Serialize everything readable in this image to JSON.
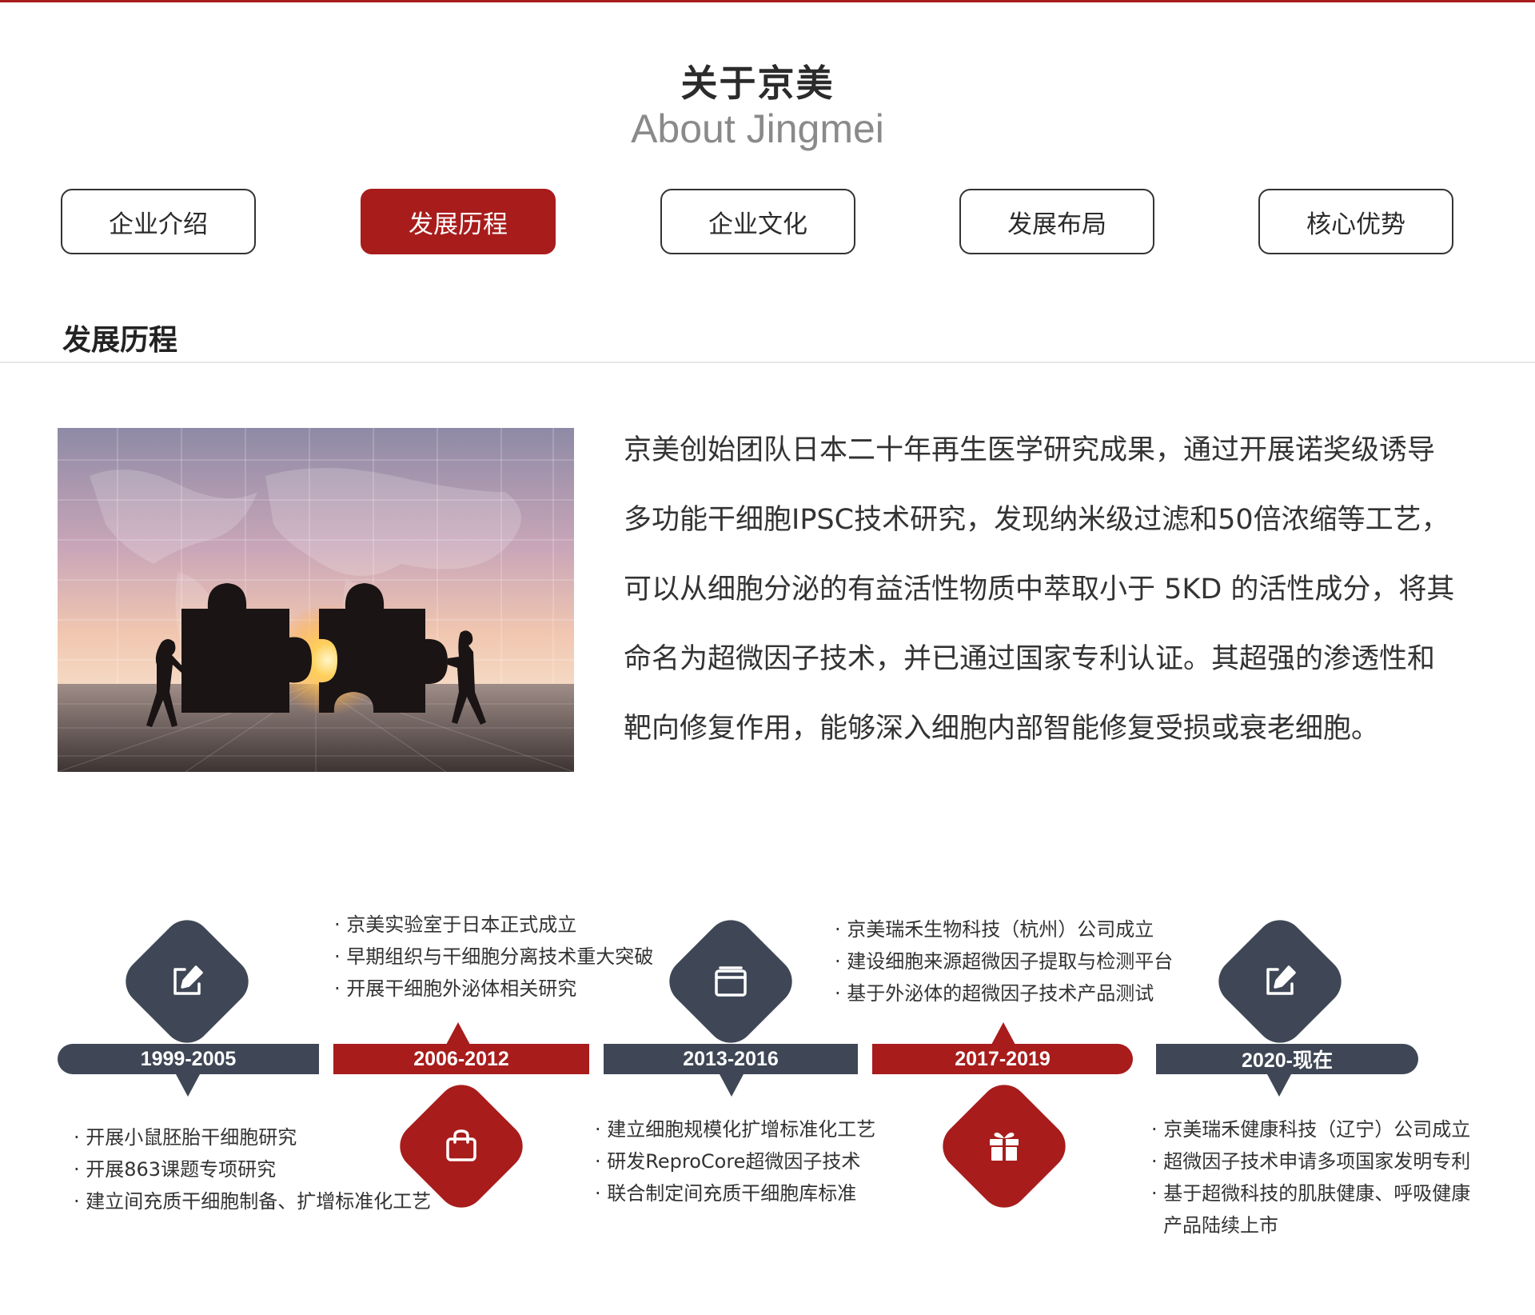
{
  "header": {
    "title_cn": "关于京美",
    "title_en": "About Jingmei"
  },
  "tabs": [
    {
      "label": "企业介绍",
      "active": false
    },
    {
      "label": "发展历程",
      "active": true
    },
    {
      "label": "企业文化",
      "active": false
    },
    {
      "label": "发展布局",
      "active": false
    },
    {
      "label": "核心优势",
      "active": false
    }
  ],
  "section": {
    "title": "发展历程"
  },
  "intro": {
    "lines": [
      "京美创始团队日本二十年再生医学研究成果，通过开展诺奖级诱导",
      "多功能干细胞IPSC技术研究，发现纳米级过滤和50倍浓缩等工艺，",
      "可以从细胞分泌的有益活性物质中萃取小于 5KD 的活性成分，将其",
      "命名为超微因子技术，并已通过国家专利认证。其超强的渗透性和",
      "靶向修复作用，能够深入细胞内部智能修复受损或衰老细胞。"
    ]
  },
  "timeline": {
    "colors": {
      "dark": "#3f4756",
      "red": "#a81c1c"
    },
    "periods": [
      {
        "label": "1999-2005",
        "icon": "edit-icon",
        "events": [
          "· 开展小鼠胚胎干细胞研究",
          "· 开展863课题专项研究",
          "· 建立间充质干细胞制备、扩增标准化工艺"
        ]
      },
      {
        "label": "2006-2012",
        "icon": "shopping-bag-icon",
        "events": [
          "· 京美实验室于日本正式成立",
          "· 早期组织与干细胞分离技术重大突破",
          "· 开展干细胞外泌体相关研究"
        ]
      },
      {
        "label": "2013-2016",
        "icon": "folder-icon",
        "events": [
          "· 建立细胞规模化扩增标准化工艺",
          "· 研发ReproCore超微因子技术",
          "· 联合制定间充质干细胞库标准"
        ]
      },
      {
        "label": "2017-2019",
        "icon": "gift-icon",
        "events": [
          "· 京美瑞禾生物科技（杭州）公司成立",
          "· 建设细胞来源超微因子提取与检测平台",
          "· 基于外泌体的超微因子技术产品测试"
        ]
      },
      {
        "label": "2020-现在",
        "icon": "edit-icon",
        "events": [
          "· 京美瑞禾健康科技（辽宁）公司成立",
          "· 超微因子技术申请多项国家发明专利",
          "· 基于超微科技的肌肤健康、呼吸健康",
          "产品陆续上市"
        ]
      }
    ]
  }
}
